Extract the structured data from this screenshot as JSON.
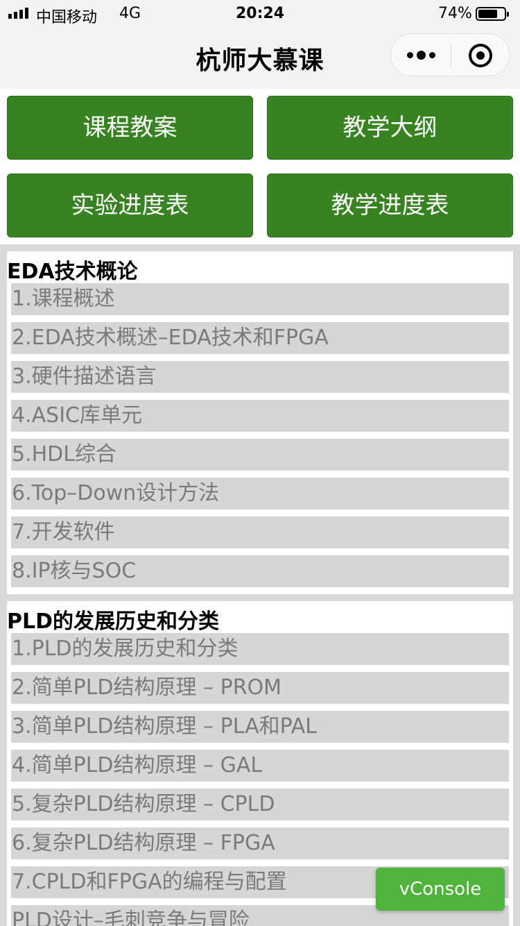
{
  "status_bar": {
    "carrier": "中国移动",
    "network": "4G",
    "time": "20:24",
    "battery_percent_text": "74%",
    "battery_level": 0.74
  },
  "nav": {
    "title": "杭师大慕课",
    "more_icon": "more-dots-icon",
    "close_icon": "target-circle-icon"
  },
  "buttons": [
    {
      "label": "课程教案"
    },
    {
      "label": "教学大纲"
    },
    {
      "label": "实验进度表"
    },
    {
      "label": "教学进度表"
    }
  ],
  "sections": [
    {
      "title": "EDA技术概论",
      "items": [
        "1.课程概述",
        "2.EDA技术概述–EDA技术和FPGA",
        "3.硬件描述语言",
        "4.ASIC库单元",
        "5.HDL综合",
        "6.Top–Down设计方法",
        "7.开发软件",
        "8.IP核与SOC"
      ]
    },
    {
      "title": "PLD的发展历史和分类",
      "items": [
        "1.PLD的发展历史和分类",
        "2.简单PLD结构原理 – PROM",
        "3.简单PLD结构原理 – PLA和PAL",
        "4.简单PLD结构原理 – GAL",
        "5.复杂PLD结构原理 – CPLD",
        "6.复杂PLD结构原理 – FPGA",
        "7.CPLD和FPGA的编程与配置",
        "PLD设计–毛刺竞争与冒险"
      ]
    }
  ],
  "vconsole": {
    "label": "vConsole"
  },
  "colors": {
    "button_green": "#378221",
    "item_bg": "#d6d6d6",
    "item_text": "#7a7a7a",
    "vconsole_green": "#4fb33c"
  }
}
